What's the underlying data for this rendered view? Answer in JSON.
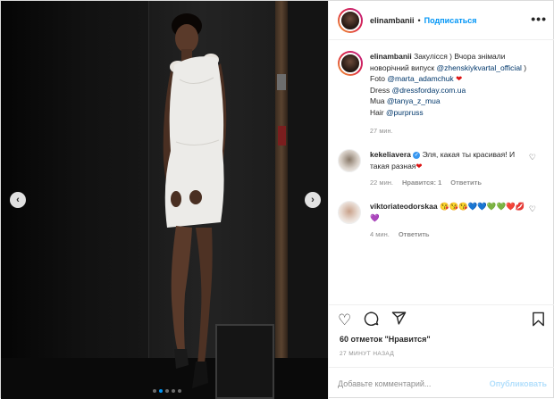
{
  "post": {
    "author": "elinambanii",
    "separator": "•",
    "follow_label": "Подписаться",
    "more_icon": "more-horizontal-icon"
  },
  "caption": {
    "username": "elinambanii",
    "line1": " Закулісся ) Вчора знімали новорічний випуск ",
    "mention1": "@zhenskiykvartal_official",
    "line1_end": " )",
    "foto_label": "Foto ",
    "foto_mention": "@marta_adamchuk",
    "dress_label": "Dress ",
    "dress_mention": "@dressforday.com.ua",
    "mua_label": "Mua ",
    "mua_mention": "@tanya_z_mua",
    "hair_label": "Hair ",
    "hair_mention": "@purpruss",
    "time": "27 мин."
  },
  "comments": [
    {
      "username": "kekeliavera",
      "verified": true,
      "text": "Эля, какая ты красивая! И такая разная",
      "time": "22 мин.",
      "likes": "Нравится: 1",
      "reply": "Ответить"
    },
    {
      "username": "viktoriateodorskaa",
      "verified": false,
      "text": "😘😘😘💙💙💚💚❤️💋💜",
      "time": "4 мин.",
      "reply": "Ответить"
    }
  ],
  "actions": {
    "like_icon": "heart-icon",
    "comment_icon": "comment-icon",
    "share_icon": "share-icon",
    "save_icon": "bookmark-icon"
  },
  "likes_text": "60 отметок \"Нравится\"",
  "posted_time": "27 МИНУТ НАЗАД",
  "add_comment": {
    "placeholder": "Добавьте комментарий...",
    "publish_label": "Опубликовать"
  },
  "carousel": {
    "dots": 5,
    "active_index": 1
  },
  "colors": {
    "accent": "#0095f6",
    "link": "#00376b",
    "muted": "#8e8e8e",
    "publish_disabled": "#b2dffc"
  }
}
